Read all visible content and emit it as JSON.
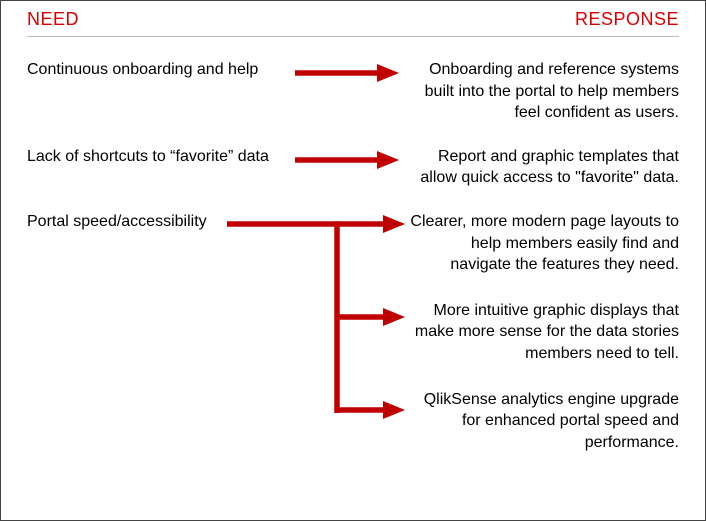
{
  "header": {
    "need_label": "NEED",
    "response_label": "RESPONSE"
  },
  "rows": [
    {
      "need": "Continuous onboarding and help",
      "responses": [
        "Onboarding and reference systems built into the portal to help members feel confident as users."
      ]
    },
    {
      "need": "Lack of shortcuts to “favorite” data",
      "responses": [
        "Report and graphic templates that allow quick access to \"favorite\" data."
      ]
    },
    {
      "need": "Portal speed/accessibility",
      "responses": [
        "Clearer, more modern page layouts to help members easily find and navigate the features they need.",
        "More intuitive graphic displays that make more sense for the data stories members need to tell.",
        "QlikSense analytics engine upgrade for enhanced portal speed and performance."
      ]
    }
  ],
  "style": {
    "arrow_color": "#c00000"
  }
}
